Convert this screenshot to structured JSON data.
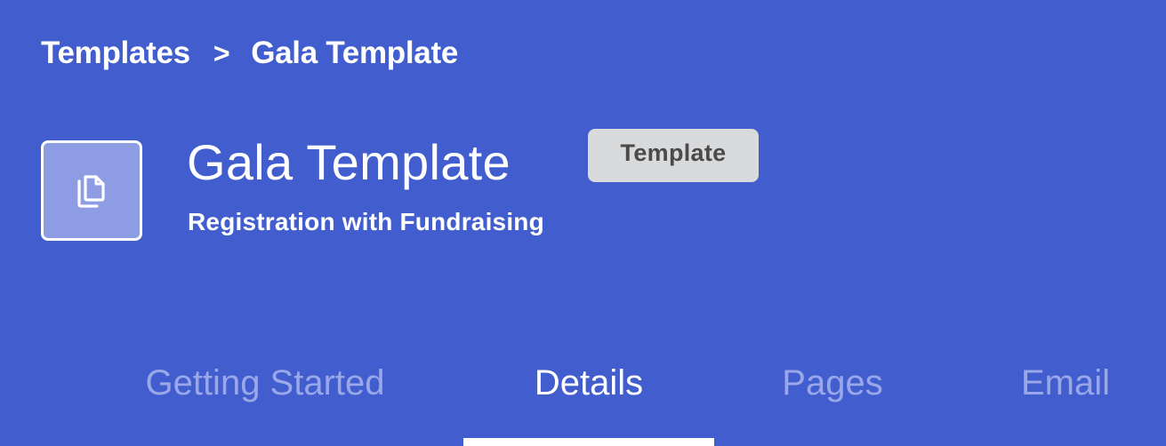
{
  "breadcrumb": {
    "parent": "Templates",
    "separator": ">",
    "current": "Gala Template"
  },
  "header": {
    "icon": "copy-document-icon",
    "title": "Gala Template",
    "badge": "Template",
    "subtitle": "Registration with Fundraising"
  },
  "tabs": [
    {
      "label": "Getting Started",
      "active": false
    },
    {
      "label": "Details",
      "active": true
    },
    {
      "label": "Pages",
      "active": false
    },
    {
      "label": "Email",
      "active": false
    }
  ],
  "colors": {
    "background": "#415dce",
    "icon_box": "#8e9de3",
    "badge_bg": "#d9dadc",
    "badge_text": "#4a4a4a",
    "inactive_tab": "#9aa8ea",
    "active_tab": "#ffffff"
  }
}
